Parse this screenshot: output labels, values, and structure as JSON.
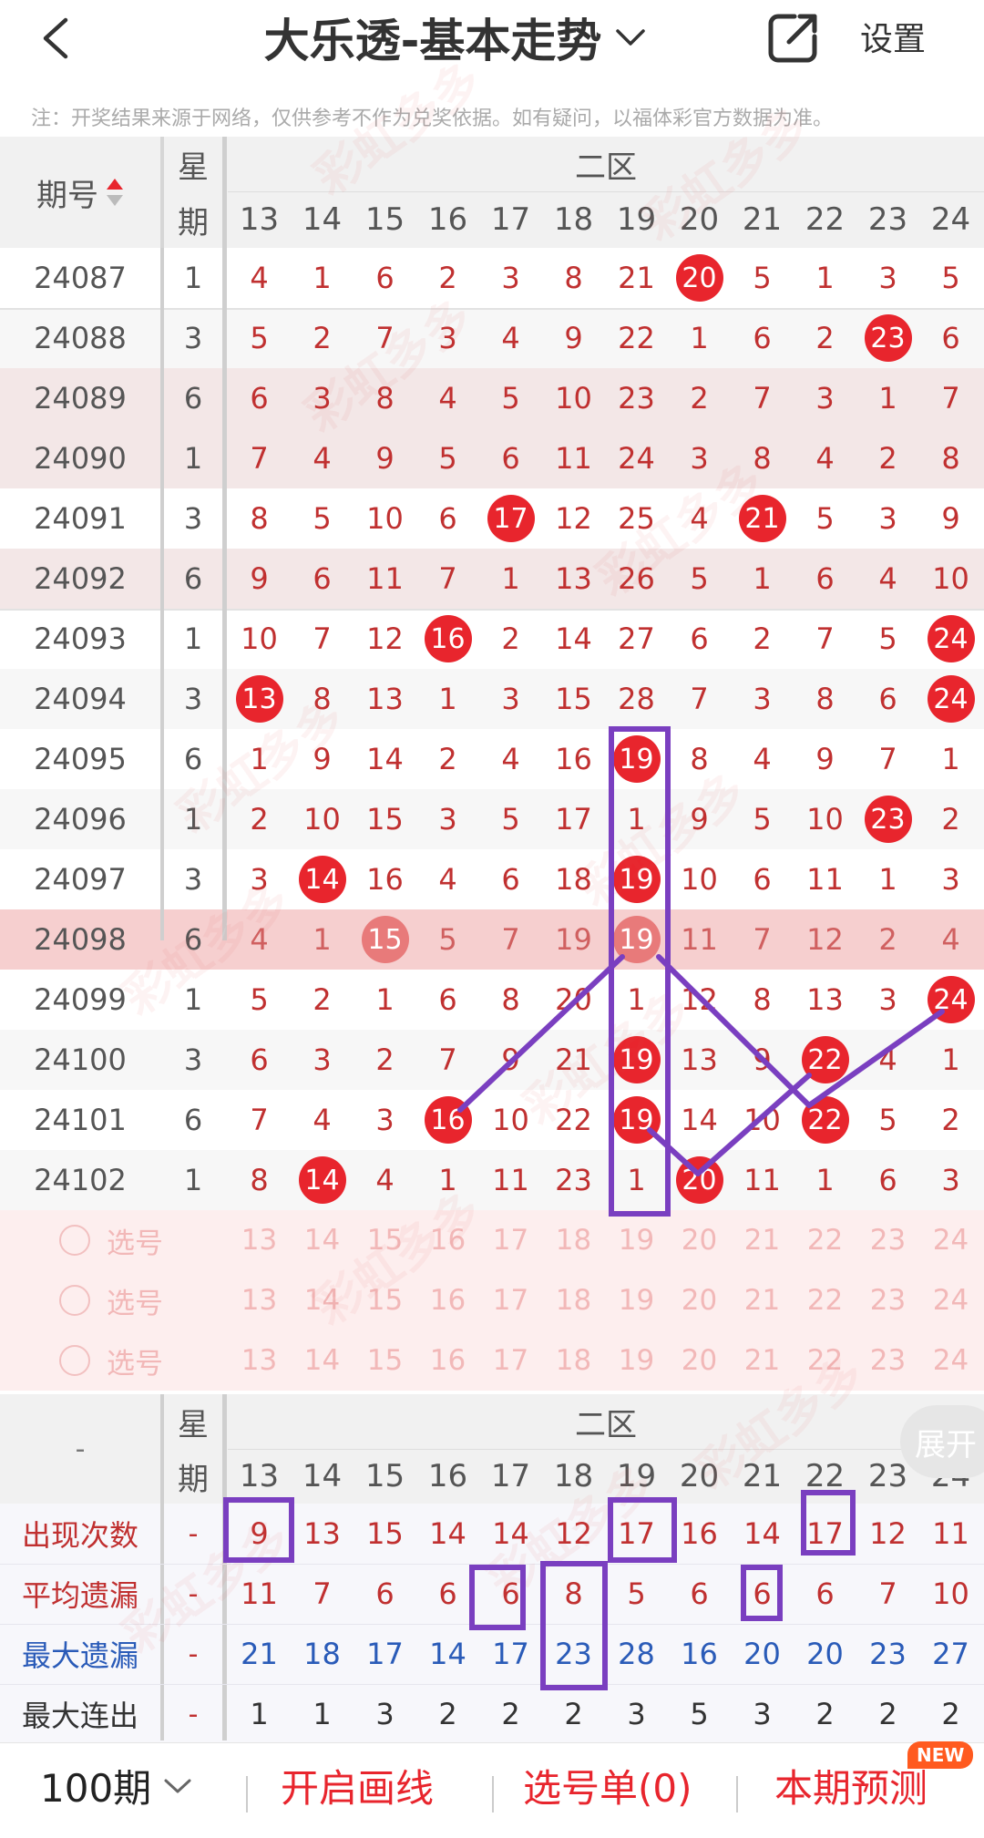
{
  "header": {
    "title": "大乐透-基本走势",
    "settings_label": "设置"
  },
  "notice": "注：开奖结果来源于网络，仅供参考不作为兑奖依据。如有疑问，以福体彩官方数据为准。",
  "table": {
    "col_issue": "期号",
    "col_week_top": "星",
    "col_week_bottom": "期",
    "zone_label": "二区",
    "columns": [
      "13",
      "14",
      "15",
      "16",
      "17",
      "18",
      "19",
      "20",
      "21",
      "22",
      "23",
      "24"
    ],
    "rows": [
      {
        "issue": "24087",
        "week": "1",
        "cells": [
          "4",
          "1",
          "6",
          "2",
          "3",
          "8",
          "21",
          "20",
          "5",
          "1",
          "3",
          "5"
        ],
        "hits": [
          7
        ]
      },
      {
        "issue": "24088",
        "week": "3",
        "cells": [
          "5",
          "2",
          "7",
          "3",
          "4",
          "9",
          "22",
          "1",
          "6",
          "2",
          "23",
          "6"
        ],
        "hits": [
          10
        ]
      },
      {
        "issue": "24089",
        "week": "6",
        "cells": [
          "6",
          "3",
          "8",
          "4",
          "5",
          "10",
          "23",
          "2",
          "7",
          "3",
          "1",
          "7"
        ],
        "hits": []
      },
      {
        "issue": "24090",
        "week": "1",
        "cells": [
          "7",
          "4",
          "9",
          "5",
          "6",
          "11",
          "24",
          "3",
          "8",
          "4",
          "2",
          "8"
        ],
        "hits": []
      },
      {
        "issue": "24091",
        "week": "3",
        "cells": [
          "8",
          "5",
          "10",
          "6",
          "17",
          "12",
          "25",
          "4",
          "21",
          "5",
          "3",
          "9"
        ],
        "hits": [
          4,
          8
        ]
      },
      {
        "issue": "24092",
        "week": "6",
        "cells": [
          "9",
          "6",
          "11",
          "7",
          "1",
          "13",
          "26",
          "5",
          "1",
          "6",
          "4",
          "10"
        ],
        "hits": []
      },
      {
        "issue": "24093",
        "week": "1",
        "cells": [
          "10",
          "7",
          "12",
          "16",
          "2",
          "14",
          "27",
          "6",
          "2",
          "7",
          "5",
          "24"
        ],
        "hits": [
          3,
          11
        ]
      },
      {
        "issue": "24094",
        "week": "3",
        "cells": [
          "13",
          "8",
          "13",
          "1",
          "3",
          "15",
          "28",
          "7",
          "3",
          "8",
          "6",
          "24"
        ],
        "hits": [
          0,
          11
        ]
      },
      {
        "issue": "24095",
        "week": "6",
        "cells": [
          "1",
          "9",
          "14",
          "2",
          "4",
          "16",
          "19",
          "8",
          "4",
          "9",
          "7",
          "1"
        ],
        "hits": [
          6
        ]
      },
      {
        "issue": "24096",
        "week": "1",
        "cells": [
          "2",
          "10",
          "15",
          "3",
          "5",
          "17",
          "1",
          "9",
          "5",
          "10",
          "23",
          "2"
        ],
        "hits": [
          10
        ]
      },
      {
        "issue": "24097",
        "week": "3",
        "cells": [
          "3",
          "14",
          "16",
          "4",
          "6",
          "18",
          "19",
          "10",
          "6",
          "11",
          "1",
          "3"
        ],
        "hits": [
          1,
          6
        ]
      },
      {
        "issue": "24098",
        "week": "6",
        "cells": [
          "4",
          "1",
          "15",
          "5",
          "7",
          "19",
          "19",
          "11",
          "7",
          "12",
          "2",
          "4"
        ],
        "hits": [
          2,
          6
        ]
      },
      {
        "issue": "24099",
        "week": "1",
        "cells": [
          "5",
          "2",
          "1",
          "6",
          "8",
          "20",
          "1",
          "12",
          "8",
          "13",
          "3",
          "24"
        ],
        "hits": [
          11
        ]
      },
      {
        "issue": "24100",
        "week": "3",
        "cells": [
          "6",
          "3",
          "2",
          "7",
          "9",
          "21",
          "19",
          "13",
          "9",
          "22",
          "4",
          "1"
        ],
        "hits": [
          6,
          9
        ]
      },
      {
        "issue": "24101",
        "week": "6",
        "cells": [
          "7",
          "4",
          "3",
          "16",
          "10",
          "22",
          "19",
          "14",
          "10",
          "22",
          "5",
          "2"
        ],
        "hits": [
          3,
          6,
          9
        ]
      },
      {
        "issue": "24102",
        "week": "1",
        "cells": [
          "8",
          "14",
          "4",
          "1",
          "11",
          "23",
          "1",
          "20",
          "11",
          "1",
          "6",
          "3"
        ],
        "hits": [
          1,
          7
        ]
      }
    ],
    "pick_label": "选号",
    "pick_rows": 3
  },
  "stats": {
    "dash": "-",
    "week_top": "星",
    "week_bottom": "期",
    "zone_label": "二区",
    "expand_label": "展开",
    "rows": [
      {
        "label": "出现次数",
        "week": "-",
        "values": [
          "9",
          "13",
          "15",
          "14",
          "14",
          "12",
          "17",
          "16",
          "14",
          "17",
          "12",
          "11"
        ],
        "color": "#c03030"
      },
      {
        "label": "平均遗漏",
        "week": "-",
        "values": [
          "11",
          "7",
          "6",
          "6",
          "6",
          "8",
          "5",
          "6",
          "6",
          "6",
          "7",
          "10"
        ],
        "color": "#c03030"
      },
      {
        "label": "最大遗漏",
        "week": "-",
        "values": [
          "21",
          "18",
          "17",
          "14",
          "17",
          "23",
          "28",
          "16",
          "20",
          "20",
          "23",
          "27"
        ],
        "color": "#2a5bb8"
      },
      {
        "label": "最大连出",
        "week": "-",
        "values": [
          "1",
          "1",
          "3",
          "2",
          "2",
          "2",
          "3",
          "5",
          "3",
          "2",
          "2",
          "2"
        ],
        "color": "#333333"
      }
    ]
  },
  "footer": {
    "period": "100期",
    "draw_line": "开启画线",
    "pick_list": "选号单(0)",
    "predict": "本期预测",
    "new_badge": "NEW"
  },
  "watermark": "彩虹多多",
  "colors": {
    "accent": "#e8252d",
    "annotation": "#7a3fc0",
    "highlight_row": "#f6cfcf",
    "pick_bg": "#fdeeee"
  }
}
